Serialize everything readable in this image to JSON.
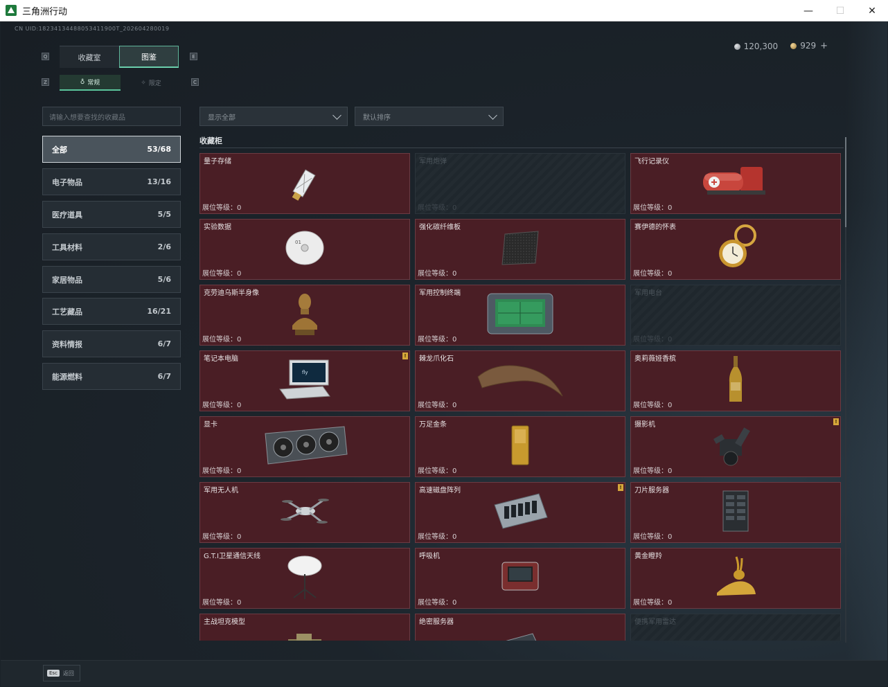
{
  "window": {
    "title": "三角洲行动",
    "minimize": "—",
    "maximize": "☐",
    "close": "✕"
  },
  "header": {
    "uid": "CN UID:18234134488053411900T_202604280019",
    "silver": "120,300",
    "gold": "929",
    "plus": "+"
  },
  "keys": {
    "q": "Q",
    "e": "E",
    "z": "Z",
    "c": "C"
  },
  "tabs": [
    {
      "label": "收藏室",
      "active": false
    },
    {
      "label": "图鉴",
      "active": true
    }
  ],
  "subtabs": [
    {
      "label": "常规",
      "active": true
    },
    {
      "label": "限定",
      "active": false
    }
  ],
  "search": {
    "placeholder": "请输入想要查找的收藏品"
  },
  "filters": {
    "display": "显示全部",
    "sort": "默认排序"
  },
  "categories": [
    {
      "label": "全部",
      "count": "53/68",
      "active": true
    },
    {
      "label": "电子物品",
      "count": "13/16"
    },
    {
      "label": "医疗道具",
      "count": "5/5"
    },
    {
      "label": "工具材料",
      "count": "2/6"
    },
    {
      "label": "家居物品",
      "count": "5/6"
    },
    {
      "label": "工艺藏品",
      "count": "16/21"
    },
    {
      "label": "资料情报",
      "count": "6/7"
    },
    {
      "label": "能源燃料",
      "count": "6/7"
    }
  ],
  "section": {
    "title": "收藏柜"
  },
  "level_label": "展位等级：0",
  "items": [
    {
      "name": "量子存储",
      "locked": false,
      "icon": "usb-drive-icon"
    },
    {
      "name": "军用炮弹",
      "locked": true,
      "icon": "shell-icon"
    },
    {
      "name": "飞行记录仪",
      "locked": false,
      "icon": "flight-recorder-icon"
    },
    {
      "name": "实验数据",
      "locked": false,
      "icon": "disc-icon"
    },
    {
      "name": "强化碳纤维板",
      "locked": false,
      "icon": "carbon-plate-icon"
    },
    {
      "name": "赛伊德的怀表",
      "locked": false,
      "icon": "pocket-watch-icon"
    },
    {
      "name": "克劳迪乌斯半身像",
      "locked": false,
      "icon": "bust-icon"
    },
    {
      "name": "军用控制终端",
      "locked": false,
      "icon": "terminal-icon"
    },
    {
      "name": "军用电台",
      "locked": true,
      "icon": "radio-icon"
    },
    {
      "name": "笔记本电脑",
      "locked": false,
      "icon": "laptop-icon",
      "badge": true
    },
    {
      "name": "棘龙爪化石",
      "locked": false,
      "icon": "claw-fossil-icon"
    },
    {
      "name": "奥莉薇娅香槟",
      "locked": false,
      "icon": "champagne-icon"
    },
    {
      "name": "显卡",
      "locked": false,
      "icon": "gpu-icon"
    },
    {
      "name": "万足金条",
      "locked": false,
      "icon": "gold-bar-icon"
    },
    {
      "name": "摄影机",
      "locked": false,
      "icon": "camera-icon",
      "badge": true
    },
    {
      "name": "军用无人机",
      "locked": false,
      "icon": "drone-icon"
    },
    {
      "name": "高速磁盘阵列",
      "locked": false,
      "icon": "disk-array-icon",
      "badge": true
    },
    {
      "name": "刀片服务器",
      "locked": false,
      "icon": "blade-server-icon"
    },
    {
      "name": "G.T.I卫星通信天线",
      "locked": false,
      "icon": "satellite-dish-icon"
    },
    {
      "name": "呼吸机",
      "locked": false,
      "icon": "ventilator-icon"
    },
    {
      "name": "黄金瞪羚",
      "locked": false,
      "icon": "gold-gazelle-icon"
    },
    {
      "name": "主战坦克模型",
      "locked": false,
      "icon": "tank-model-icon"
    },
    {
      "name": "绝密服务器",
      "locked": false,
      "icon": "server-icon"
    },
    {
      "name": "便携军用雷达",
      "locked": true,
      "icon": "radar-icon"
    }
  ],
  "footer": {
    "esc_key": "Esc",
    "esc_label": "返回"
  }
}
